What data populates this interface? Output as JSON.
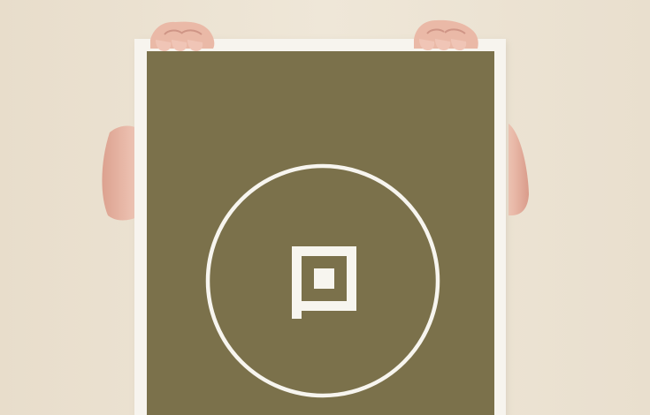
{
  "scene": {
    "description_colors": {
      "background": "#ece3d2",
      "skin": "#e8b8a6",
      "skin_shadow": "#d79e8d",
      "poster_frame": "#f6f3ec",
      "poster_field": "#7a7049",
      "emblem": "#f7f5ef"
    },
    "icons": {
      "emblem": "circle-with-square-p-logo"
    }
  }
}
